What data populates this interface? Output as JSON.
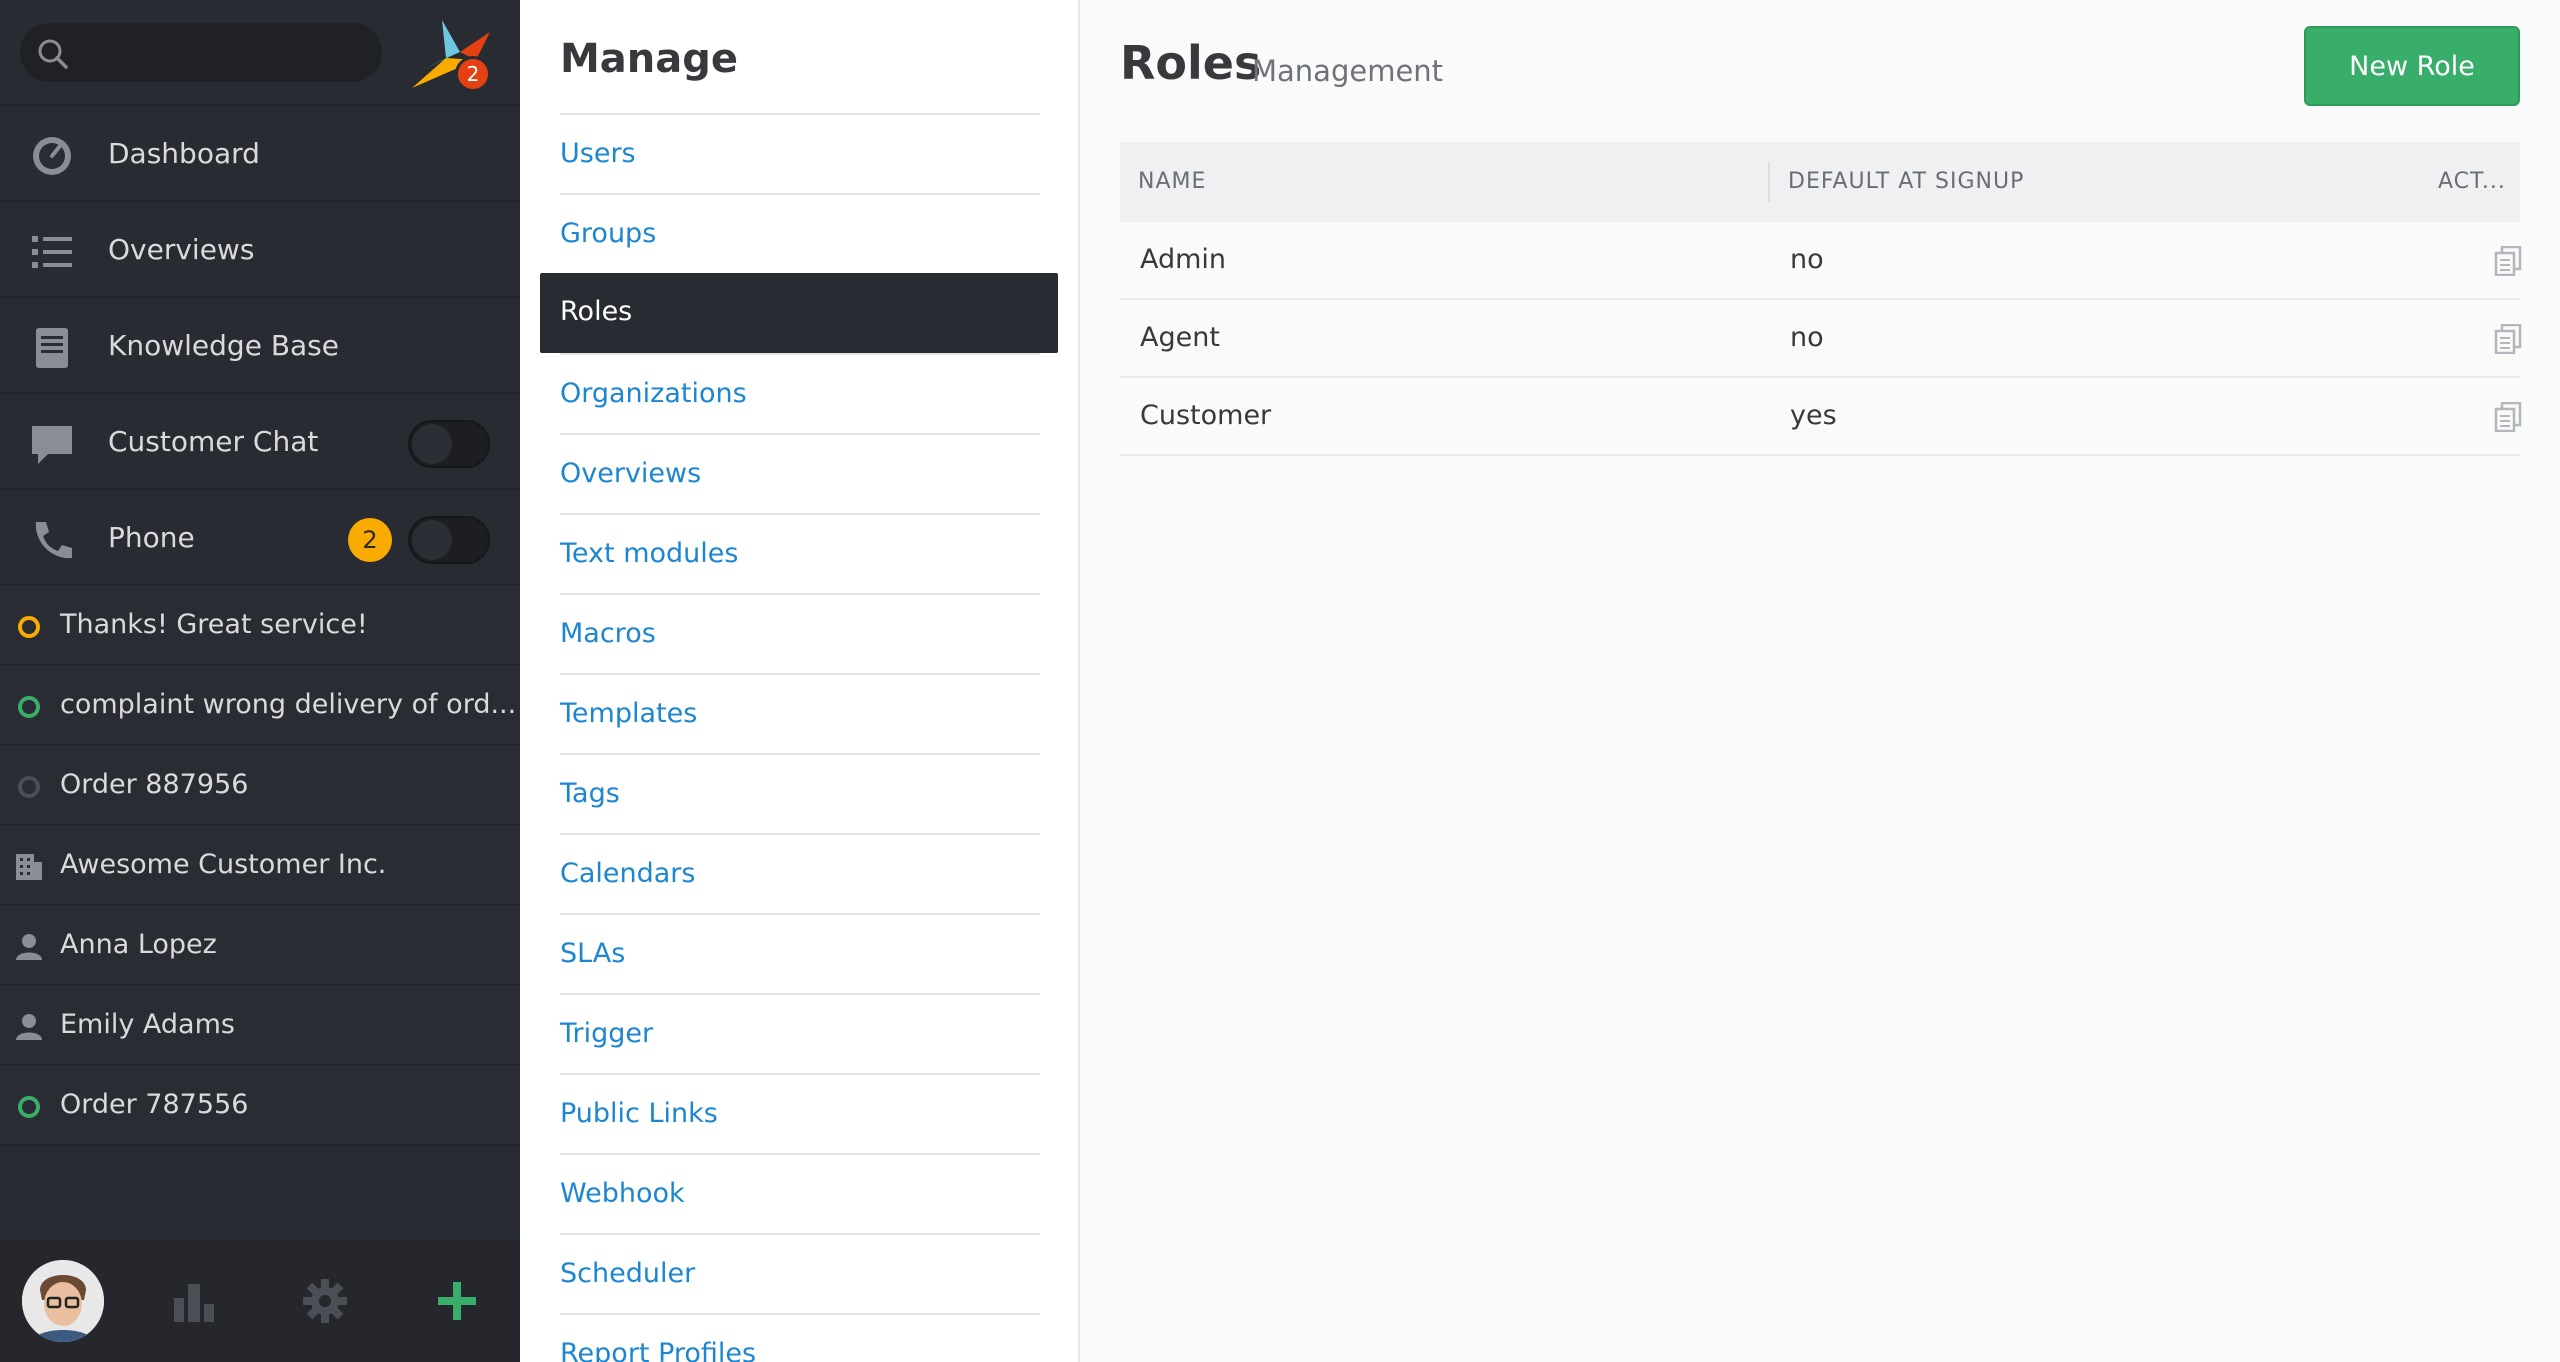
{
  "sidebar": {
    "search_placeholder": "",
    "logo_badge": "2",
    "nav": [
      {
        "label": "Dashboard",
        "icon": "dashboard-icon"
      },
      {
        "label": "Overviews",
        "icon": "list-icon"
      },
      {
        "label": "Knowledge Base",
        "icon": "book-icon"
      },
      {
        "label": "Customer Chat",
        "icon": "chat-icon",
        "toggle": false
      },
      {
        "label": "Phone",
        "icon": "phone-icon",
        "badge": "2",
        "toggle": false
      }
    ],
    "tasks": [
      {
        "label": "Thanks! Great service!",
        "icon": "ticket-status-open-icon",
        "color": "#faab00"
      },
      {
        "label": "complaint wrong delivery of ord...",
        "icon": "ticket-status-new-icon",
        "color": "#38ae6a"
      },
      {
        "label": "Order 887956",
        "icon": "ticket-status-closed-icon",
        "color": "#4b4e55"
      },
      {
        "label": "Awesome Customer Inc.",
        "icon": "organization-icon",
        "color": "#8a8d93"
      },
      {
        "label": "Anna Lopez",
        "icon": "person-icon",
        "color": "#8a8d93"
      },
      {
        "label": "Emily Adams",
        "icon": "person-icon",
        "color": "#8a8d93"
      },
      {
        "label": "Order 787556",
        "icon": "ticket-status-new-icon",
        "color": "#38ae6a"
      }
    ]
  },
  "manage": {
    "title": "Manage",
    "items": [
      "Users",
      "Groups",
      "Roles",
      "Organizations",
      "Overviews",
      "Text modules",
      "Macros",
      "Templates",
      "Tags",
      "Calendars",
      "SLAs",
      "Trigger",
      "Public Links",
      "Webhook",
      "Scheduler",
      "Report Profiles"
    ],
    "active": "Roles"
  },
  "content": {
    "title": "Roles",
    "subtitle": "Management",
    "new_button": "New Role",
    "columns": [
      "NAME",
      "DEFAULT AT SIGNUP",
      "ACT..."
    ],
    "rows": [
      {
        "name": "Admin",
        "default": "no"
      },
      {
        "name": "Agent",
        "default": "no"
      },
      {
        "name": "Customer",
        "default": "yes"
      }
    ]
  },
  "colors": {
    "accent_green": "#38ae6a",
    "link_blue": "#1d86d0",
    "sidebar_bg": "#292b33",
    "badge_yellow": "#faab00",
    "badge_red": "#e54011"
  }
}
